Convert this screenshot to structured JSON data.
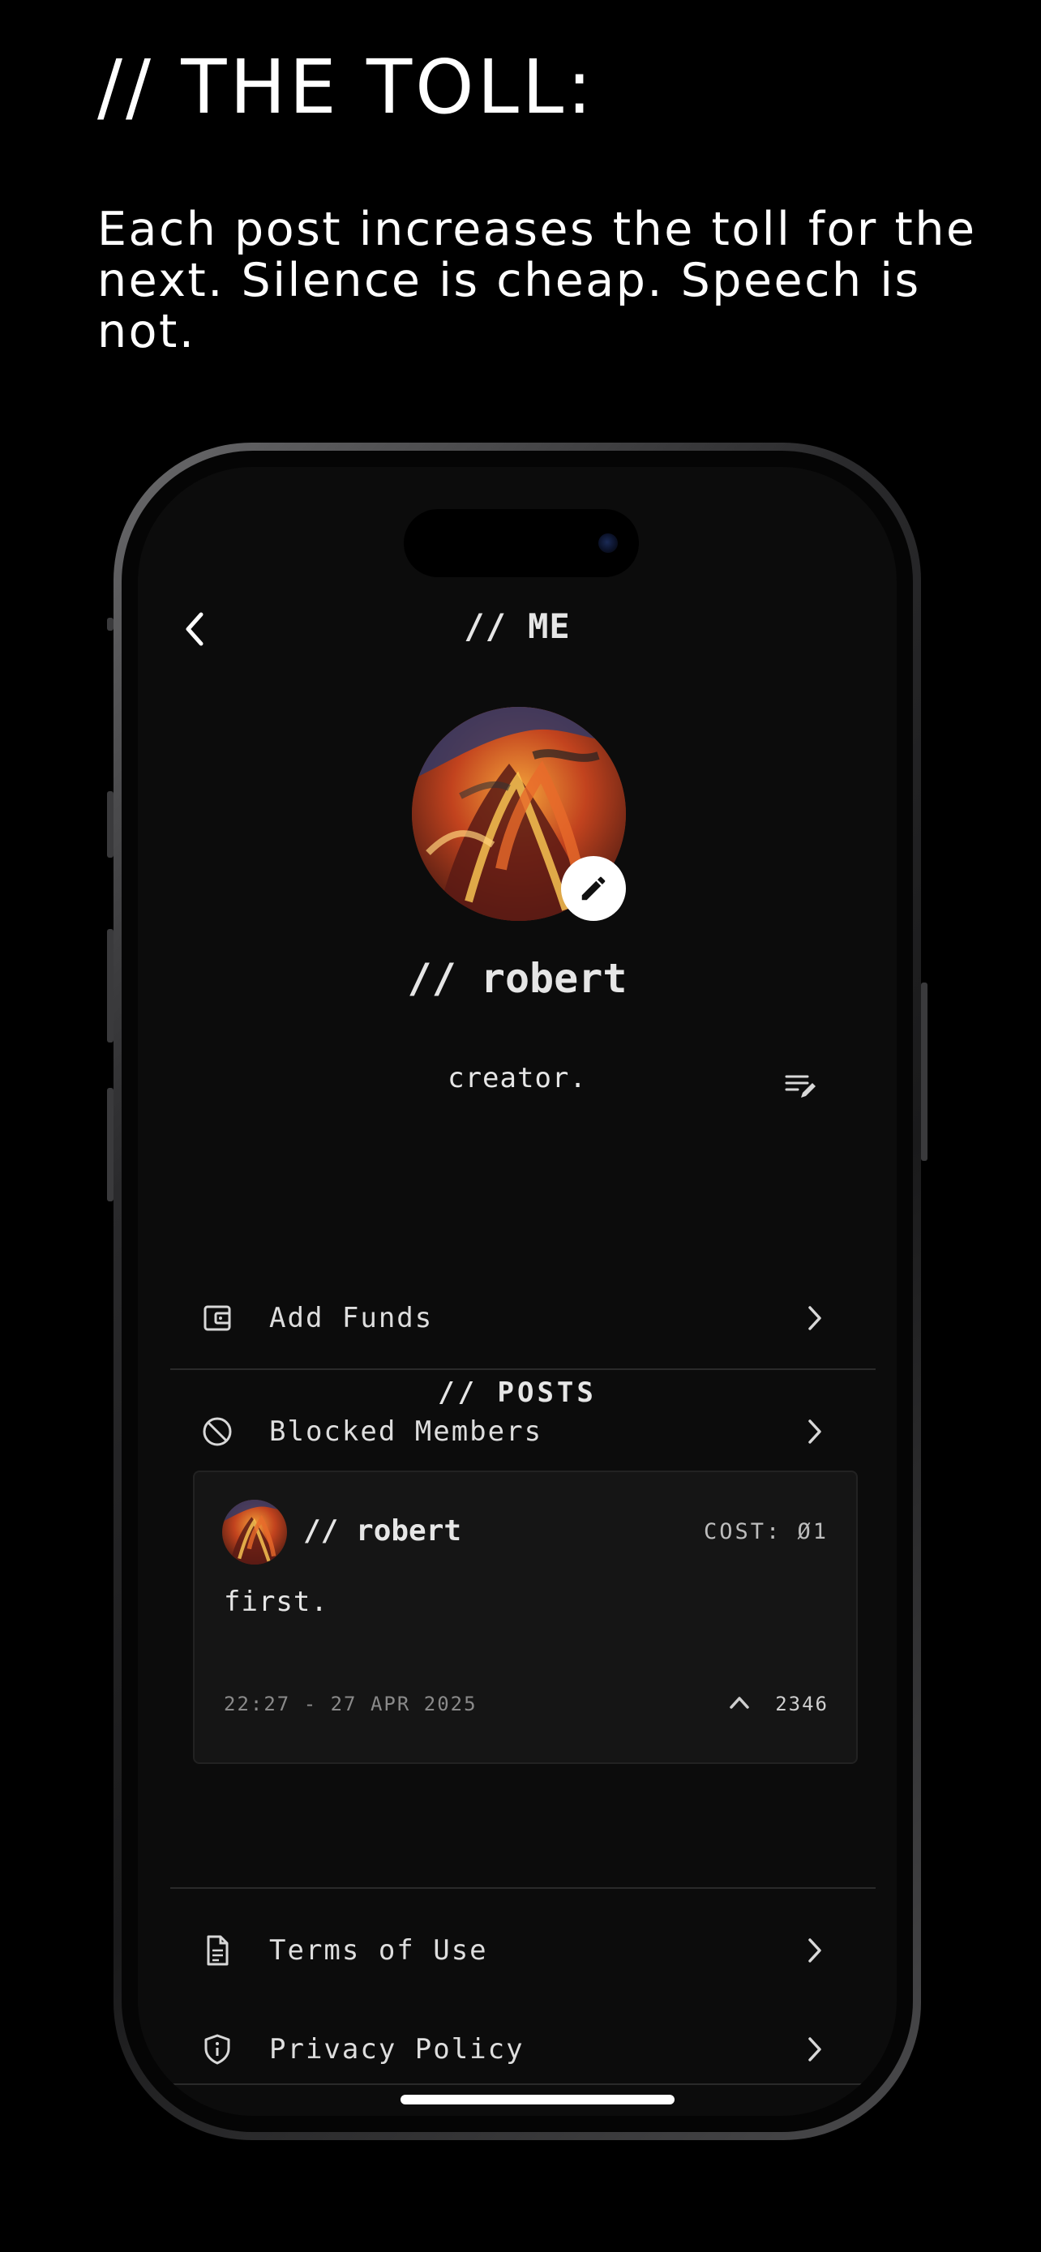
{
  "promo": {
    "title": "// THE TOLL:",
    "subtitle": "Each post increases the toll for the next. Silence is cheap. Speech is not."
  },
  "header": {
    "title": "// ME",
    "back_icon": "chevron-left-icon"
  },
  "profile": {
    "username": "// robert",
    "bio": "creator.",
    "edit_avatar_icon": "pencil-icon",
    "edit_bio_icon": "edit-note-icon"
  },
  "menu_top": [
    {
      "label": "Add Funds",
      "icon": "wallet-icon"
    },
    {
      "label": "Blocked Members",
      "icon": "block-icon"
    }
  ],
  "posts_section": {
    "title": "// POSTS",
    "posts": [
      {
        "author": "// robert",
        "cost": "COST: Ø1",
        "body": "first.",
        "timestamp": "22:27 - 27 APR 2025",
        "votes": "2346"
      }
    ]
  },
  "menu_bottom": [
    {
      "label": "Terms of Use",
      "icon": "document-icon"
    },
    {
      "label": "Privacy Policy",
      "icon": "shield-info-icon"
    }
  ],
  "colors": {
    "background": "#000000",
    "screen": "#0c0c0c",
    "card": "#151515",
    "text": "#e6e6e6",
    "muted": "#8a8a8a"
  }
}
